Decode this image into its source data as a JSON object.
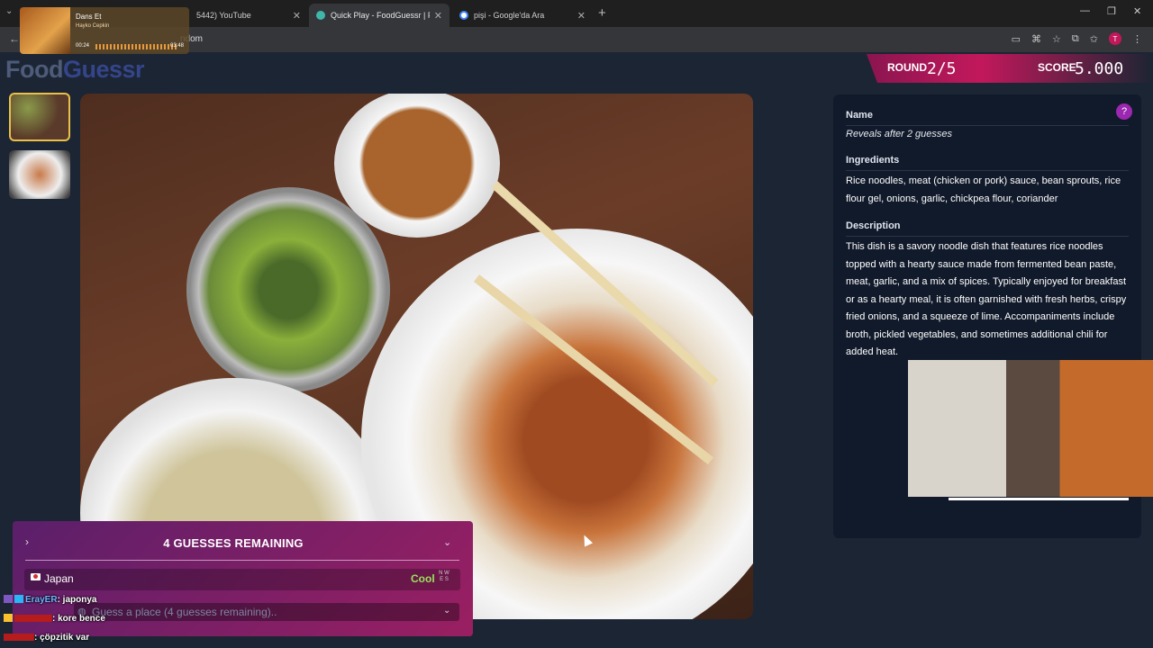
{
  "browser": {
    "tabs": [
      {
        "label": "5442) YouTube"
      },
      {
        "label": "Quick Play - FoodGuessr | Food"
      },
      {
        "label": "pişi - Google'da Ara"
      }
    ],
    "url": "ndom"
  },
  "music": {
    "title": "Dans Et",
    "artist": "Hayko Cepkin",
    "elapsed": "00:24",
    "duration": "03:48"
  },
  "logo": {
    "part1": "Food",
    "part2": "Guessr"
  },
  "status": {
    "round_label": "ROUND",
    "round_value": "2/5",
    "score_label": "SCORE",
    "score_value": "5.000"
  },
  "info": {
    "help_icon": "?",
    "name_label": "Name",
    "name_value": "Reveals after 2 guesses",
    "ingredients_label": "Ingredients",
    "ingredients_text": "Rice noodles, meat (chicken or pork) sauce, bean sprouts, rice flour gel, onions, garlic, chickpea flour, coriander",
    "description_label": "Description",
    "description_text": "This dish is a savory noodle dish that features rice noodles topped with a hearty sauce made from fermented bean paste, meat, garlic, and a mix of spices. Typically enjoyed for breakfast or as a hearty meal, it is often garnished with fresh herbs, crispy fried onions, and a squeeze of lime. Accompaniments include broth, pickled vegetables, and sometimes additional chili for added heat."
  },
  "guess": {
    "remaining_title": "4 GUESSES REMAINING",
    "guesses": [
      {
        "country": "Japan",
        "hint": "Cool",
        "compass": "N W E S"
      }
    ],
    "placeholder": "Guess a place (4 guesses remaining).."
  },
  "chat": [
    {
      "user": "ErayER",
      "message": ": japonya"
    },
    {
      "user": "",
      "message": ": kore bence"
    },
    {
      "user": "",
      "message": ": çöpzitik var"
    }
  ]
}
